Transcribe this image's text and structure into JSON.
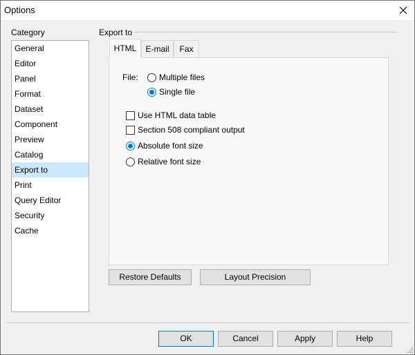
{
  "window": {
    "title": "Options"
  },
  "category": {
    "label": "Category",
    "items": [
      "General",
      "Editor",
      "Panel",
      "Format",
      "Dataset",
      "Component",
      "Preview",
      "Catalog",
      "Export to",
      "Print",
      "Query Editor",
      "Security",
      "Cache"
    ],
    "selected": "Export to"
  },
  "export": {
    "group_label": "Export to",
    "tabs": [
      "HTML",
      "E-mail",
      "Fax"
    ],
    "active_tab": "HTML",
    "file_label": "File:",
    "file_options": {
      "multiple": "Multiple files",
      "single": "Single file",
      "selected": "Single file"
    },
    "use_html_table": {
      "label": "Use HTML data table",
      "checked": false
    },
    "section508": {
      "label": "Section 508 compliant output",
      "checked": false
    },
    "font_size": {
      "absolute": "Absolute font size",
      "relative": "Relative font size",
      "selected": "Absolute font size"
    },
    "restore_defaults": "Restore Defaults",
    "layout_precision": "Layout Precision"
  },
  "footer": {
    "ok": "OK",
    "cancel": "Cancel",
    "apply": "Apply",
    "help": "Help"
  },
  "icons": {
    "close": "close-icon",
    "resize": "resize-grip-icon"
  },
  "colors": {
    "accent": "#0078d7",
    "selection": "#cce8ff"
  }
}
